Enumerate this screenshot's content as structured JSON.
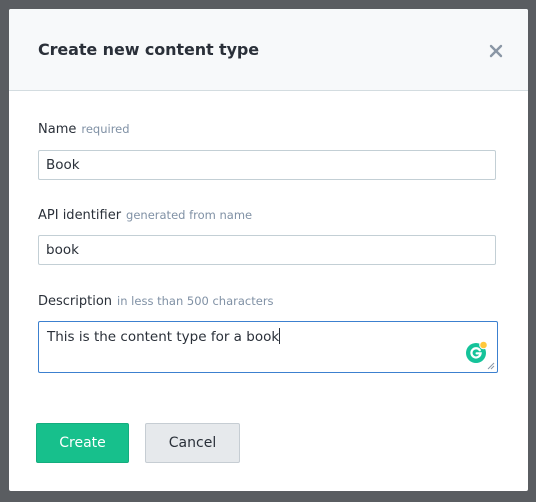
{
  "modal": {
    "title": "Create new content type"
  },
  "fields": {
    "name": {
      "label": "Name",
      "hint": "required",
      "value": "Book"
    },
    "api_identifier": {
      "label": "API identifier",
      "hint": "generated from name",
      "value": "book"
    },
    "description": {
      "label": "Description",
      "hint": "in less than 500 characters",
      "value": "This is the content type for a book"
    }
  },
  "buttons": {
    "create": "Create",
    "cancel": "Cancel"
  },
  "icons": {
    "close": "close-icon",
    "grammarly": "grammarly-icon",
    "resize": "resize-handle-icon"
  },
  "colors": {
    "primary": "#17c08c",
    "focus_border": "#3c80cf",
    "grammarly": "#15c39a",
    "grammarly_badge": "#ffc83c"
  }
}
